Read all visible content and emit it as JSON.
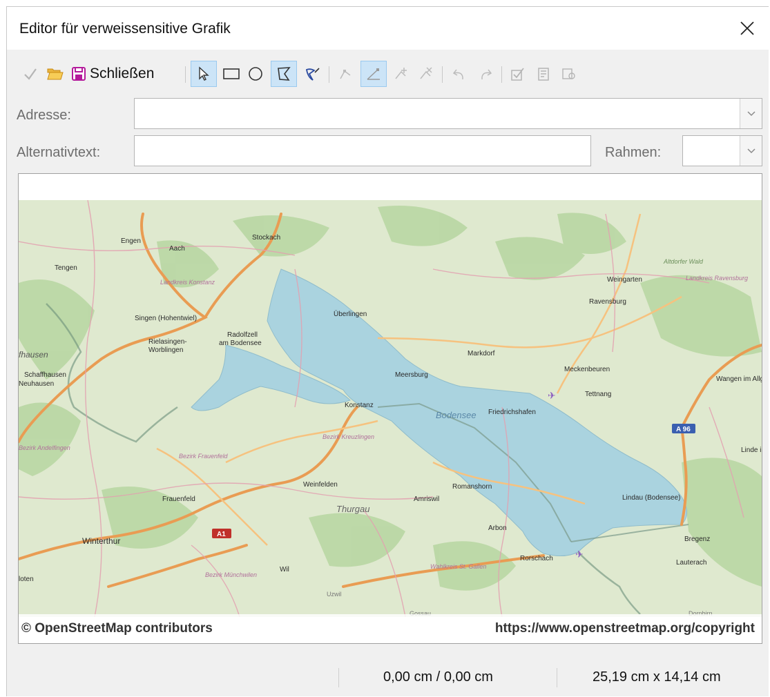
{
  "window": {
    "title": "Editor für verweissensitive Grafik"
  },
  "toolbar": {
    "close_label": "Schließen",
    "icons": [
      "apply-icon",
      "open-icon",
      "save-icon",
      "select-icon",
      "rectangle-icon",
      "ellipse-icon",
      "polygon-icon",
      "freeform-polygon-icon",
      "edit-points-icon",
      "move-points-icon",
      "insert-points-icon",
      "delete-points-icon",
      "undo-icon",
      "redo-icon",
      "active-icon",
      "macro-icon",
      "properties-icon"
    ]
  },
  "form": {
    "address_label": "Adresse:",
    "address_value": "",
    "alt_text_label": "Alternativtext:",
    "alt_text_value": "",
    "frame_label": "Rahmen:",
    "frame_value": ""
  },
  "map": {
    "labels": {
      "engen": "Engen",
      "aach": "Aach",
      "stockach": "Stockach",
      "tengen": "Tengen",
      "landkreis_konstanz": "Landkreis Konstanz",
      "singen": "Singen (Hohentwiel)",
      "rielasingen": "Rielasingen-",
      "worblingen": "Worblingen",
      "radolfzell": "Radolfzell",
      "am_bodensee": "am Bodensee",
      "ueberlingen": "Überlingen",
      "markdorf": "Markdorf",
      "meersburg": "Meersburg",
      "meckenbeuren": "Meckenbeuren",
      "tettnang": "Tettnang",
      "friedrichshafen": "Friedrichshafen",
      "konstanz": "Konstanz",
      "bodensee": "Bodensee",
      "weingarten": "Weingarten",
      "ravensburg": "Ravensburg",
      "altdorfer_wald": "Altdorfer Wald",
      "landkreis_ravensburg": "Landkreis Ravensburg",
      "schaffhausen": "Schaffhausen",
      "neuhausen": "Neuhausen",
      "fhausen": "fhausen",
      "wangen": "Wangen im Allgäu",
      "a96": "A 96",
      "bezirk_kreuzlingen": "Bezirk Kreuzlingen",
      "bezirk_andelfingen": "Bezirk Andelfingen",
      "bezirk_frauenfeld": "Bezirk Frauenfeld",
      "weinfelden": "Weinfelden",
      "romanshorn": "Romanshorn",
      "amriswil": "Amriswil",
      "frauenfeld": "Frauenfeld",
      "thurgau": "Thurgau",
      "lindau": "Lindau (Bodensee)",
      "arbon": "Arbon",
      "a1": "A1",
      "winterthur": "Winterthur",
      "bregenz": "Bregenz",
      "rorschach": "Rorschach",
      "lauterach": "Lauterach",
      "wil": "Wil",
      "wahlkreis": "Wahlkreis St. Gallen",
      "bezirk_muenchwilen": "Bezirk Münchwilen",
      "uzwil": "Uzwil",
      "gossau": "Gossau",
      "dornbirn": "Dornbirn",
      "loten": "loten",
      "linde": "Linde im A"
    },
    "attribution_left": "© OpenStreetMap contributors",
    "attribution_right": "https://www.openstreetmap.org/copyright"
  },
  "status": {
    "position": "0,00 cm / 0,00 cm",
    "size": "25,19 cm x 14,14 cm"
  },
  "colors": {
    "accent_active": "#cce4f7",
    "water": "#aad3df",
    "land": "#dfe9cf",
    "motorway": "#e99c53"
  }
}
